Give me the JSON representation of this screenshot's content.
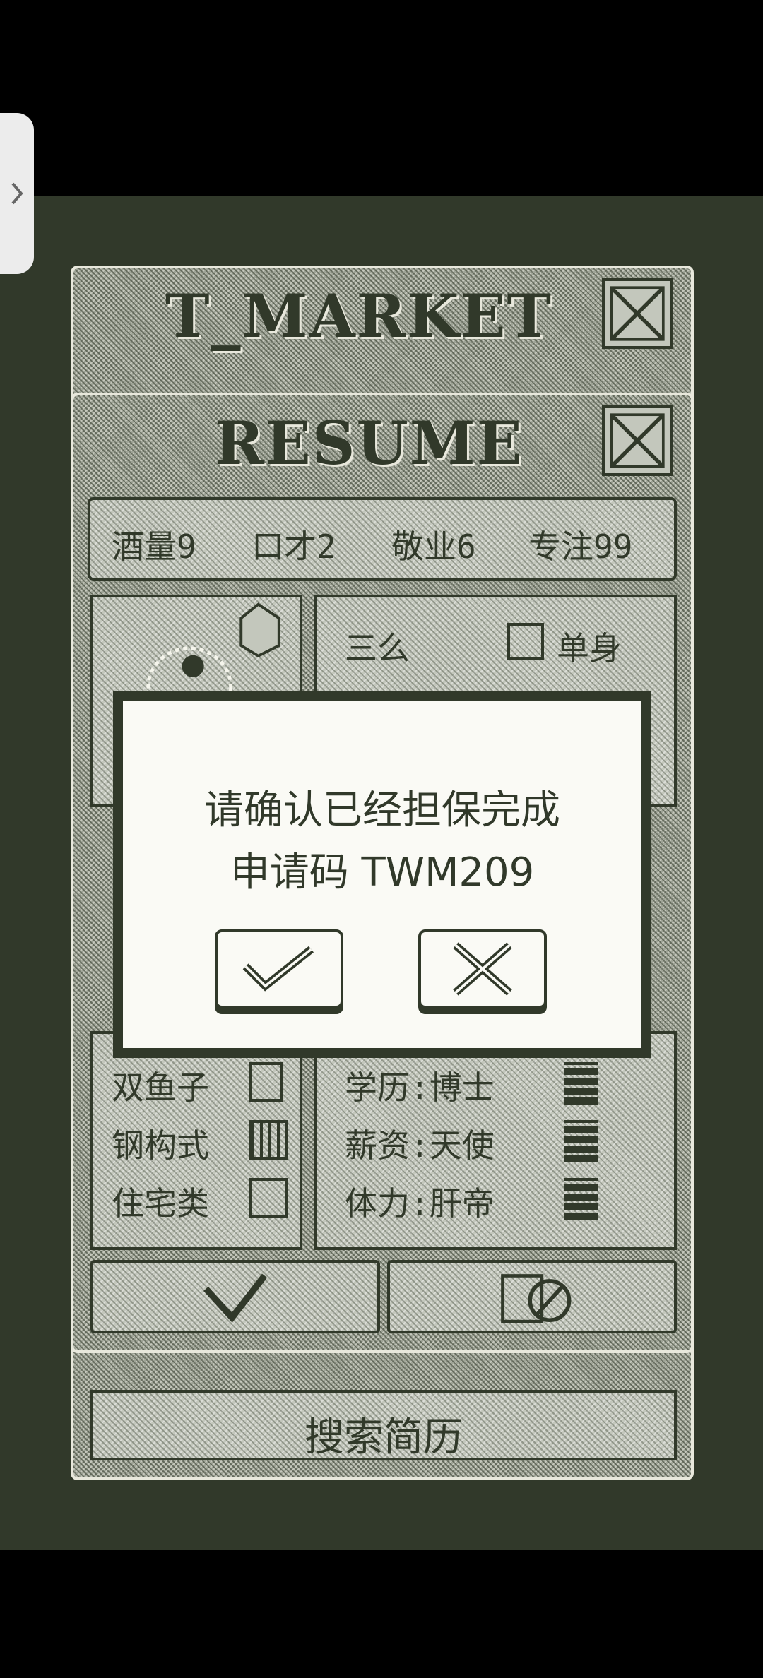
{
  "market": {
    "title": "T_MARKET"
  },
  "resume": {
    "title": "RESUME",
    "stats": [
      "酒量9",
      "口才2",
      "敬业6",
      "专注99"
    ],
    "name": "三么",
    "gender": "单身",
    "skills": [
      "双鱼子",
      "钢构式",
      "住宅类"
    ],
    "attributes": [
      "学历:博士",
      "薪资:天使",
      "体力:肝帝"
    ]
  },
  "search": {
    "label": "搜索简历"
  },
  "dialog": {
    "line1": "请确认已经担保完成",
    "line2": "申请码 TWM209",
    "confirm_icon": "check-icon",
    "cancel_icon": "cross-icon"
  },
  "colors": {
    "dark": "#31392a",
    "light": "#fafaf5",
    "mid": "#9fa497"
  }
}
